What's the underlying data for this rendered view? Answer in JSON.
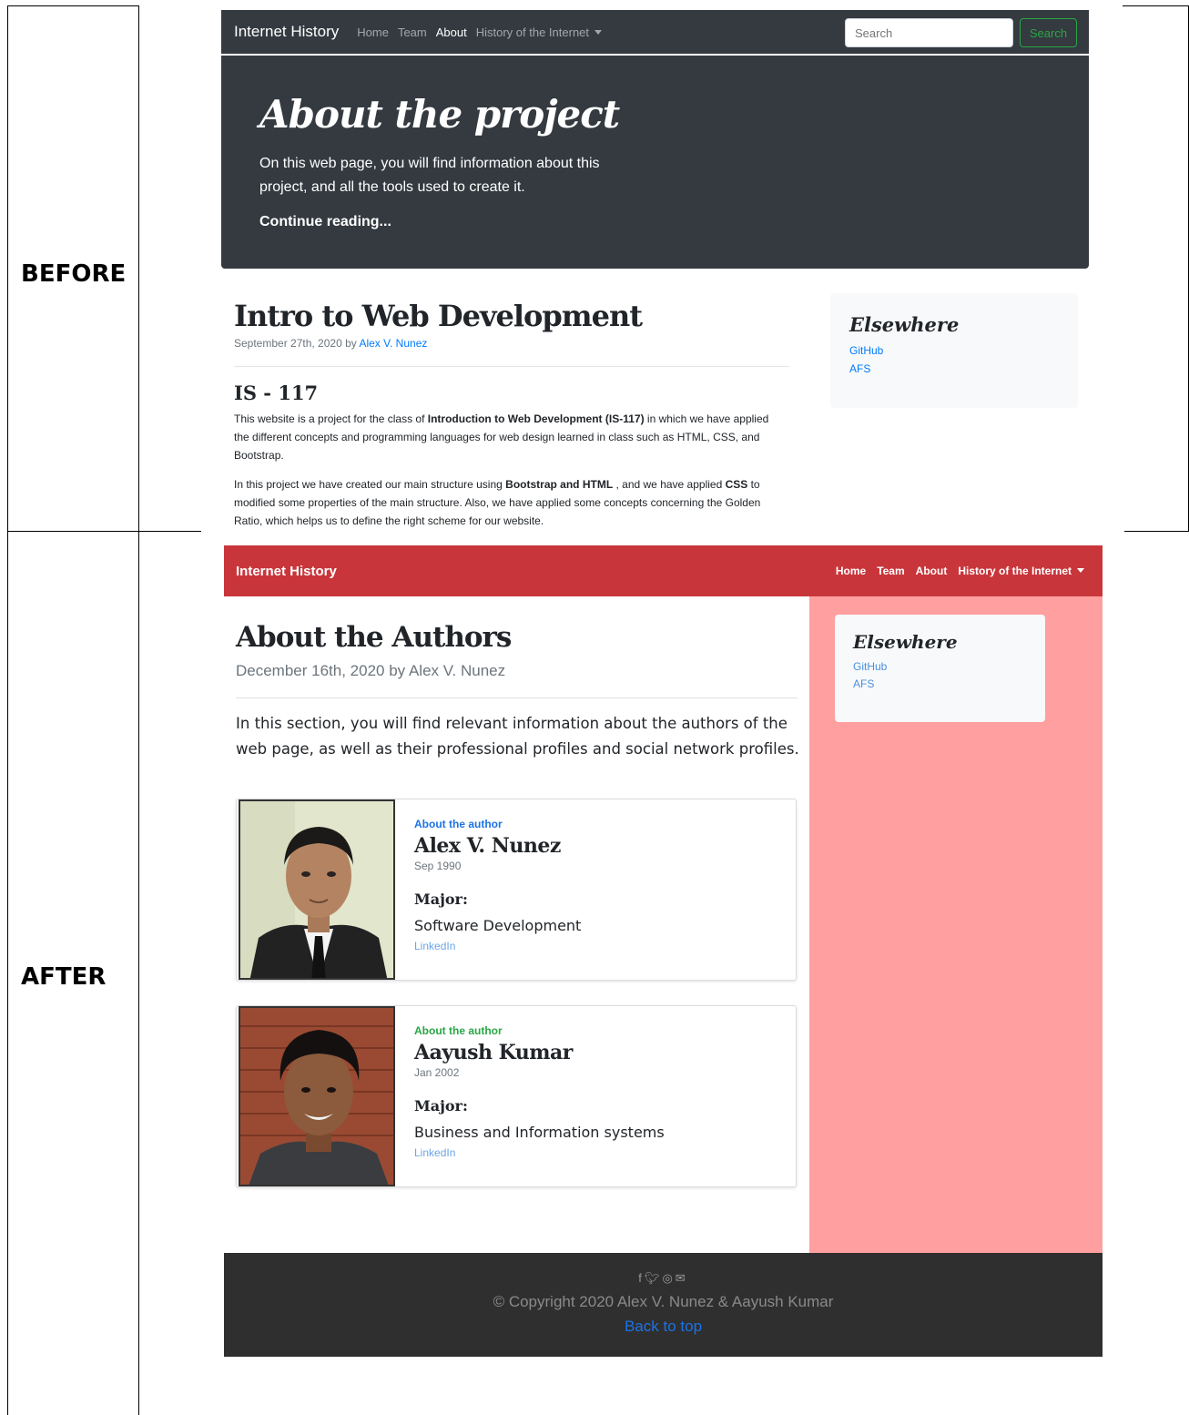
{
  "labels": {
    "before": "BEFORE",
    "after": "AFTER"
  },
  "before": {
    "nav": {
      "brand": "Internet History",
      "links": [
        "Home",
        "Team",
        "About",
        "History of the Internet"
      ],
      "active": "About",
      "search_placeholder": "Search",
      "search_button": "Search"
    },
    "jumbotron": {
      "title": "About the project",
      "text": "On this web page, you will find information about this project, and all the tools used to create it.",
      "cta": "Continue reading..."
    },
    "post": {
      "title": "Intro to Web Development",
      "date_prefix": "September 27th, 2020 by",
      "author": "Alex V. Nunez",
      "subtitle": "IS - 117",
      "p1_a": "This website is a project for the class of ",
      "p1_b": "Introduction to Web Development (IS-117)",
      "p1_c": " in which we have applied the different concepts and programming languages for web design learned in class such as HTML, CSS, and Bootstrap.",
      "p2_a": "In this project we have created our main structure using ",
      "p2_b": "Bootstrap and HTML",
      "p2_c": " , and we have applied ",
      "p2_d": "CSS",
      "p2_e": " to modified some properties of the main structure. Also, we have applied some concepts concerning the Golden Ratio, which helps us to define the right scheme for our website."
    },
    "aside": {
      "title": "Elsewhere",
      "links": [
        "GitHub",
        "AFS"
      ]
    }
  },
  "after": {
    "nav": {
      "brand": "Internet History",
      "links": [
        "Home",
        "Team",
        "About",
        "History of the Internet"
      ]
    },
    "title": "About the Authors",
    "meta": "December 16th, 2020 by Alex V. Nunez",
    "intro": "In this section, you will find relevant information about the authors of the web page, as well as their professional profiles and social network profiles.",
    "authors": [
      {
        "kicker": "About the author",
        "kicker_color": "#1a73e8",
        "name": "Alex V. Nunez",
        "date": "Sep 1990",
        "major_label": "Major:",
        "major": "Software Development",
        "link": "LinkedIn"
      },
      {
        "kicker": "About the author",
        "kicker_color": "#28a745",
        "name": "Aayush Kumar",
        "date": "Jan 2002",
        "major_label": "Major:",
        "major": "Business and Information systems",
        "link": "LinkedIn"
      }
    ],
    "aside": {
      "title": "Elsewhere",
      "links": [
        "GitHub",
        "AFS"
      ]
    },
    "footer": {
      "icons": [
        "facebook-icon",
        "twitter-icon",
        "instagram-icon",
        "envelope-icon"
      ],
      "copyright": "© Copyright 2020 Alex V. Nunez & Aayush Kumar",
      "back_to_top": "Back to top"
    },
    "colors": {
      "navbar": "#c8363b",
      "sidebar": "#ff9f9f",
      "footer": "#2f2f2f"
    }
  }
}
